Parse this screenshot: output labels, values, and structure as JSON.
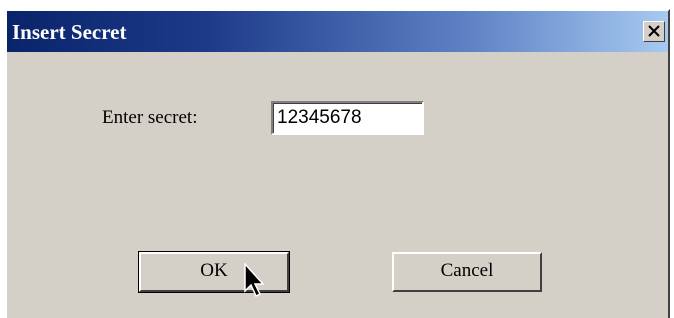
{
  "window": {
    "title": "Insert Secret",
    "close_icon": "close-icon"
  },
  "form": {
    "label": "Enter secret:",
    "secret_value": "12345678"
  },
  "buttons": {
    "ok_label": "OK",
    "cancel_label": "Cancel"
  },
  "colors": {
    "titlebar_start": "#0a246a",
    "titlebar_end": "#a6caf0",
    "face": "#d4d0c8"
  },
  "cursor_icon": "arrow-cursor-icon"
}
